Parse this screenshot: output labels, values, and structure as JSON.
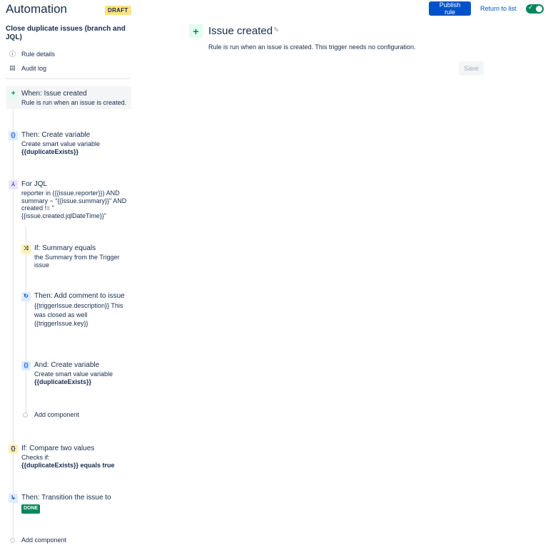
{
  "header": {
    "title": "Automation",
    "badge": "DRAFT",
    "publish_label": "Publish rule",
    "return_label": "Return to list",
    "toggle_on": true
  },
  "sidebar": {
    "rule_name": "Close duplicate issues (branch and JQL)",
    "links": [
      {
        "label": "Rule details",
        "icon": "info-icon"
      },
      {
        "label": "Audit log",
        "icon": "document-icon"
      }
    ],
    "components": [
      {
        "title": "When: Issue created",
        "body": "Rule is run when an issue is created.",
        "icon": "plus-icon"
      },
      {
        "title": "Then: Create variable",
        "body": "Create smart value variable",
        "bold": "{{duplicateExists}}",
        "icon": "braces-icon"
      },
      {
        "title": "For JQL",
        "body": "reporter in ({{issue.reporter}}) AND summary ~ \"{{issue.summary}}\" AND created != \"{{issue.created.jqlDateTime}}\"",
        "icon": "branch-icon"
      },
      {
        "title": "If: Summary equals",
        "body": "the Summary from the Trigger issue",
        "icon": "shuffle-icon"
      },
      {
        "title": "Then: Add comment to issue",
        "body": "{{triggerIssue.description}} This was closed as well {{triggerIssue.key}}",
        "icon": "refresh-icon"
      },
      {
        "title": "And: Create variable",
        "body": "Create smart value variable",
        "bold": "{{duplicateExists}}",
        "icon": "braces-icon"
      },
      {
        "title": "If: Compare two values",
        "body": "Checks if:",
        "bold": "{{duplicateExists}} equals true",
        "icon": "braces-icon"
      },
      {
        "title": "Then: Transition the issue to",
        "badge": "DONE",
        "icon": "transition-icon"
      }
    ],
    "add_component_label": "Add component"
  },
  "main": {
    "title": "Issue created",
    "description": "Rule is run when an issue is created. This trigger needs no configuration.",
    "save_label": "Save"
  }
}
